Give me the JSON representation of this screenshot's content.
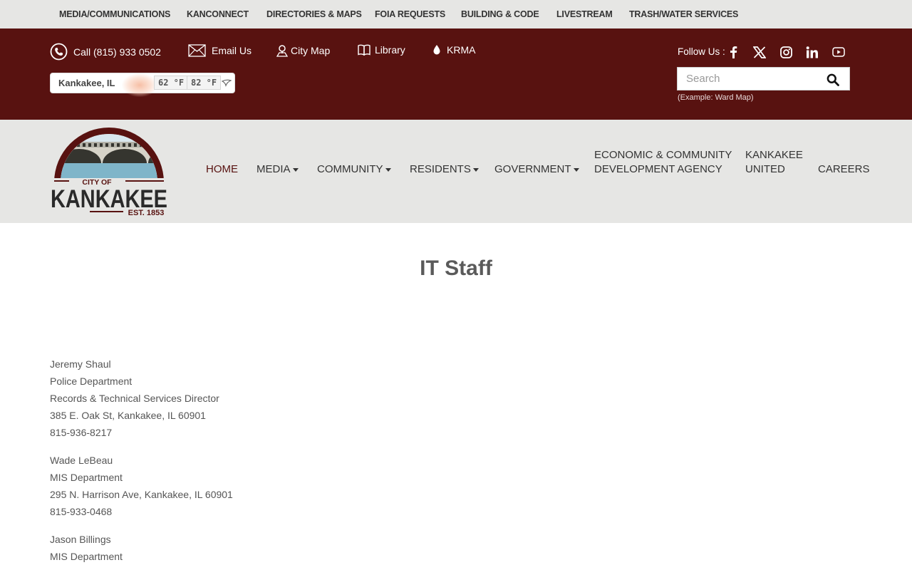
{
  "top_nav": [
    {
      "label": "MEDIA/COMMUNICATIONS"
    },
    {
      "label": "KANCONNECT"
    },
    {
      "label": "DIRECTORIES & MAPS"
    },
    {
      "label": "FOIA REQUESTS"
    },
    {
      "label": "BUILDING & CODE"
    },
    {
      "label": "LIVESTREAM"
    },
    {
      "label": "TRASH/WATER SERVICES"
    }
  ],
  "contacts": [
    {
      "label": "Call (815) 933 0502",
      "icon": "phone-icon"
    },
    {
      "label": "Email Us",
      "icon": "envelope-icon"
    },
    {
      "label": "City Map",
      "icon": "map-pin-icon"
    },
    {
      "label": "Library",
      "icon": "book-icon"
    },
    {
      "label": "KRMA",
      "icon": "water-drop-icon"
    }
  ],
  "weather": {
    "city": "Kankakee, IL",
    "low": "62 °F",
    "high": "82 °F"
  },
  "follow": {
    "label": "Follow Us :"
  },
  "social": [
    "facebook-icon",
    "x-icon",
    "instagram-icon",
    "linkedin-icon",
    "youtube-icon"
  ],
  "search": {
    "placeholder": "Search",
    "hint": "(Example: Ward Map)"
  },
  "logo": {
    "top": "CITY OF",
    "name": "KANKAKEE",
    "est": "EST. 1853"
  },
  "main_nav": [
    {
      "label": "HOME",
      "active": true
    },
    {
      "label": "MEDIA",
      "dropdown": true
    },
    {
      "label": "COMMUNITY",
      "dropdown": true
    },
    {
      "label": "RESIDENTS",
      "dropdown": true
    },
    {
      "label": "GOVERNMENT",
      "dropdown": true
    },
    {
      "line1": "ECONOMIC & COMMUNITY",
      "line2": "DEVELOPMENT AGENCY"
    },
    {
      "line1": "KANKAKEE",
      "line2": "UNITED"
    },
    {
      "label": "CAREERS"
    }
  ],
  "page": {
    "title": "IT Staff"
  },
  "staff": [
    {
      "lines": [
        "Jeremy Shaul",
        "Police Department",
        "Records & Technical Services Director",
        "385 E. Oak St, Kankakee, IL  60901",
        "815-936-8217"
      ]
    },
    {
      "lines": [
        "Wade LeBeau",
        "MIS Department",
        "295 N. Harrison Ave, Kankakee, IL  60901",
        "815-933-0468"
      ]
    },
    {
      "lines": [
        "Jason Billings",
        "MIS Department"
      ]
    }
  ],
  "colors": {
    "maroon": "#581210",
    "nav_bg": "#e6e6e4",
    "active": "#581210"
  }
}
